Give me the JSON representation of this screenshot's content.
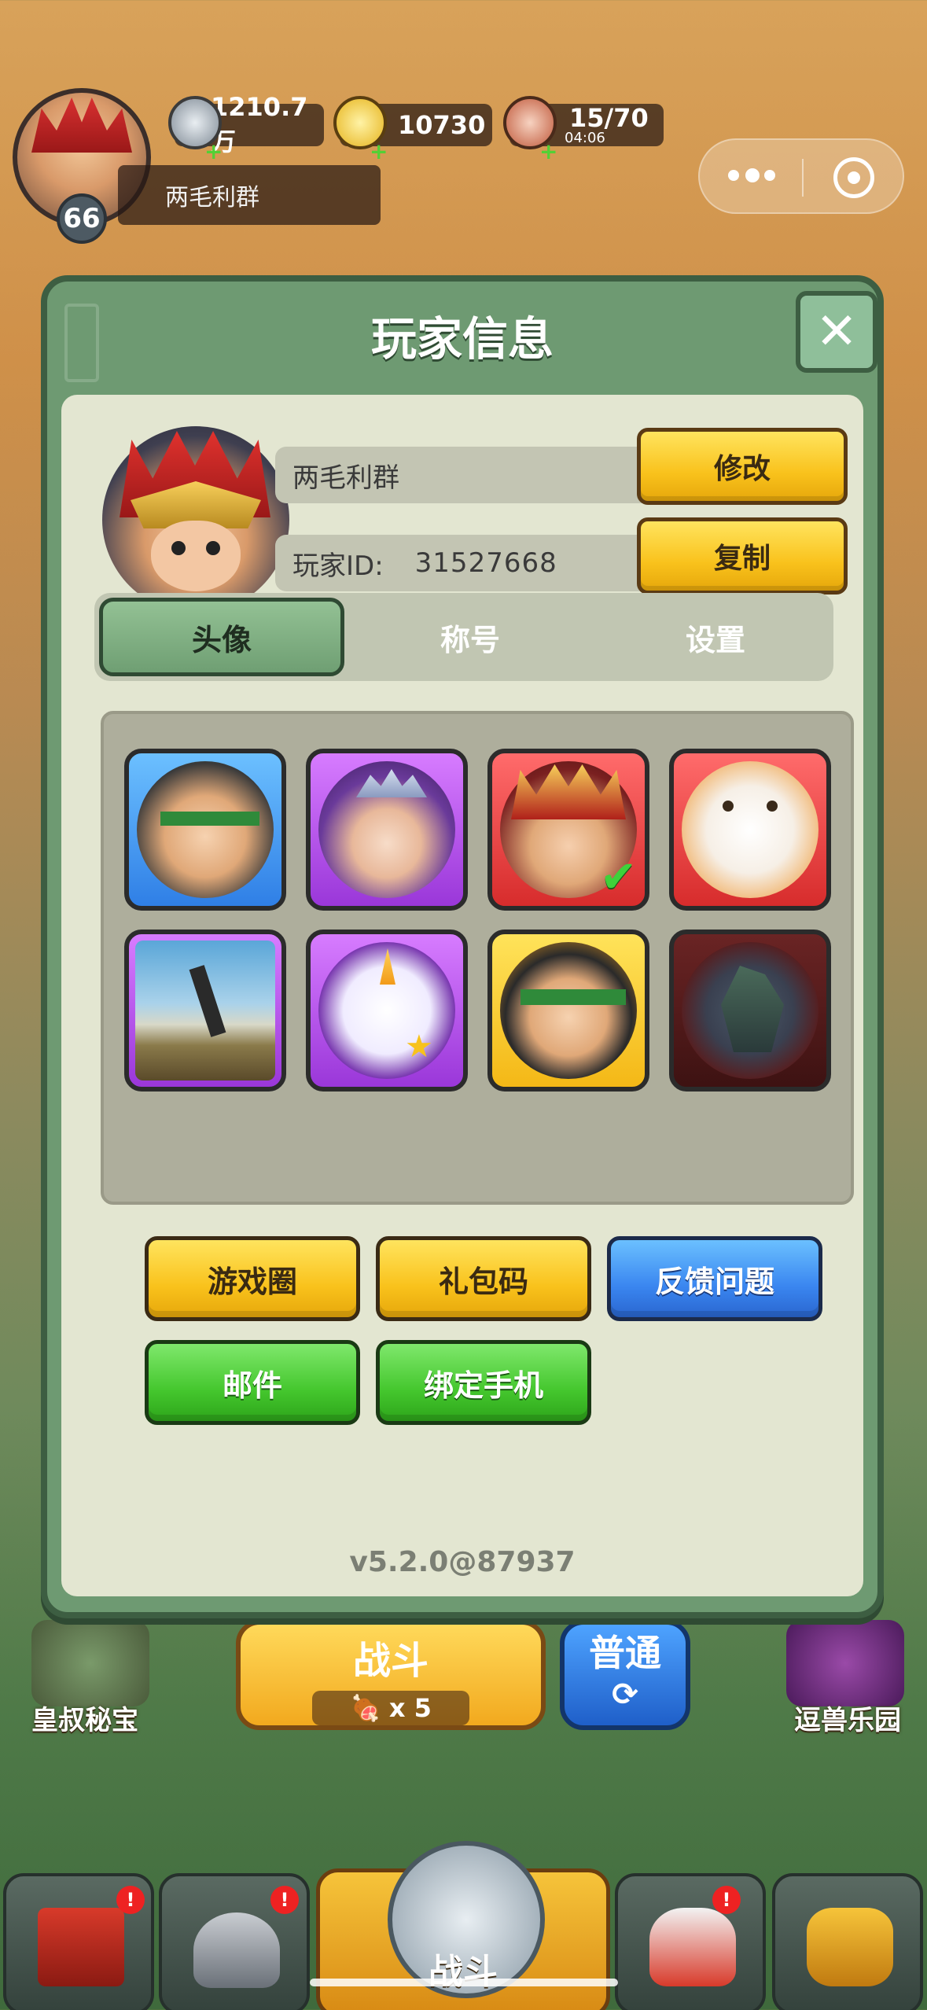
{
  "hud": {
    "level": "66",
    "silver": "1210.7万",
    "gold": "10730",
    "stamina": "15/70",
    "stamina_timer": "04:06",
    "player_name": "两毛利群"
  },
  "modal": {
    "title": "玩家信息",
    "name_value": "两毛利群",
    "edit_label": "修改",
    "id_label": "玩家ID:",
    "id_value": "31527668",
    "copy_label": "复制",
    "tabs": [
      "头像",
      "称号",
      "设置"
    ],
    "active_tab": "头像",
    "avatars": [
      {
        "name": "green-headband-warrior",
        "frame": "blue",
        "selected": false
      },
      {
        "name": "purple-hair-princess",
        "frame": "purple",
        "selected": false
      },
      {
        "name": "red-helmet-warrior",
        "frame": "red",
        "selected": true
      },
      {
        "name": "lucky-cat",
        "frame": "red",
        "selected": false
      },
      {
        "name": "photo-person-jumping",
        "frame": "purple",
        "selected": false
      },
      {
        "name": "unicorn",
        "frame": "purple",
        "selected": false
      },
      {
        "name": "laughing-headband-warrior",
        "frame": "yellow",
        "selected": false
      },
      {
        "name": "dark-dragon",
        "frame": "dark",
        "selected": false
      }
    ],
    "actions": {
      "game_circle": "游戏圈",
      "gift_code": "礼包码",
      "feedback": "反馈问题",
      "mail": "邮件",
      "bind_phone": "绑定手机"
    },
    "version": "v5.2.0@87937"
  },
  "background": {
    "battle_label": "战斗",
    "battle_cost": "x 5",
    "normal_label": "普通",
    "left_feature": "皇叔秘宝",
    "right_feature": "逗兽乐园",
    "nav_center_label": "战斗"
  },
  "colors": {
    "modal_green": "#6e9a72",
    "panel_cream": "#e3e6d1",
    "button_yellow": "#f9c21c",
    "button_blue": "#3a86f0",
    "button_green": "#45c72e"
  }
}
